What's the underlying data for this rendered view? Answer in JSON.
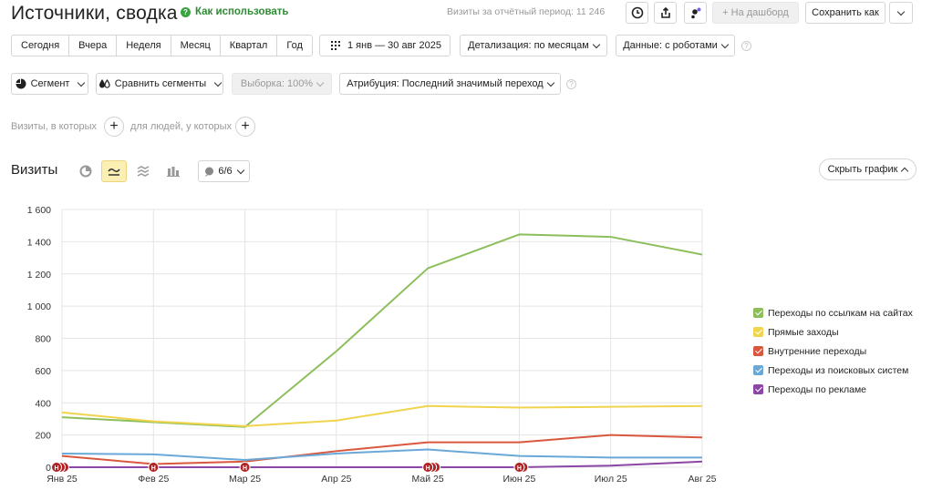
{
  "header": {
    "title": "Источники, сводка",
    "howto_label": "Как использовать",
    "visits_period": "Визиты за отчётный период: 11 246",
    "dashboard_label": "+ На дашборд",
    "save_label": "Сохранить как"
  },
  "toolbar": {
    "periods": [
      "Сегодня",
      "Вчера",
      "Неделя",
      "Месяц",
      "Квартал",
      "Год"
    ],
    "date_range": "1 янв — 30 авг 2025",
    "detail": "Детализация: по месяцам",
    "data_mode": "Данные: с роботами"
  },
  "segments": {
    "segment_label": "Сегмент",
    "compare_label": "Сравнить сегменты",
    "sample_label": "Выборка: 100%",
    "attribution_label": "Атрибуция: Последний значимый переход"
  },
  "filters": {
    "visits_label": "Визиты, в которых",
    "people_label": "для людей, у которых"
  },
  "chart_section": {
    "title": "Визиты",
    "series_selector": "6/6",
    "hide_chart": "Скрыть график"
  },
  "chart_data": {
    "type": "line",
    "categories": [
      "Янв 25",
      "Фев 25",
      "Мар 25",
      "Апр 25",
      "Май 25",
      "Июн 25",
      "Июл 25",
      "Авг 25"
    ],
    "y_ticks": [
      "0",
      "200",
      "400",
      "600",
      "800",
      "1 000",
      "1 200",
      "1 400",
      "1 600"
    ],
    "ylim": [
      0,
      1600
    ],
    "grid": true,
    "legend_position": "right",
    "series": [
      {
        "name": "Переходы по ссылкам на сайтах",
        "color": "#8cbf5c",
        "values": [
          310,
          280,
          250,
          720,
          1235,
          1445,
          1430,
          1320
        ]
      },
      {
        "name": "Прямые заходы",
        "color": "#f0d44e",
        "values": [
          340,
          285,
          255,
          290,
          380,
          370,
          375,
          380
        ]
      },
      {
        "name": "Внутренние переходы",
        "color": "#d9573f",
        "values": [
          70,
          20,
          35,
          100,
          155,
          155,
          200,
          185
        ]
      },
      {
        "name": "Переходы из поисковых систем",
        "color": "#6aa8d8",
        "values": [
          85,
          80,
          45,
          85,
          110,
          70,
          60,
          60
        ]
      },
      {
        "name": "Переходы по рекламе",
        "color": "#8b46a6",
        "values": [
          0,
          0,
          0,
          0,
          0,
          0,
          10,
          35
        ]
      }
    ],
    "annotation_marker": "Н"
  }
}
